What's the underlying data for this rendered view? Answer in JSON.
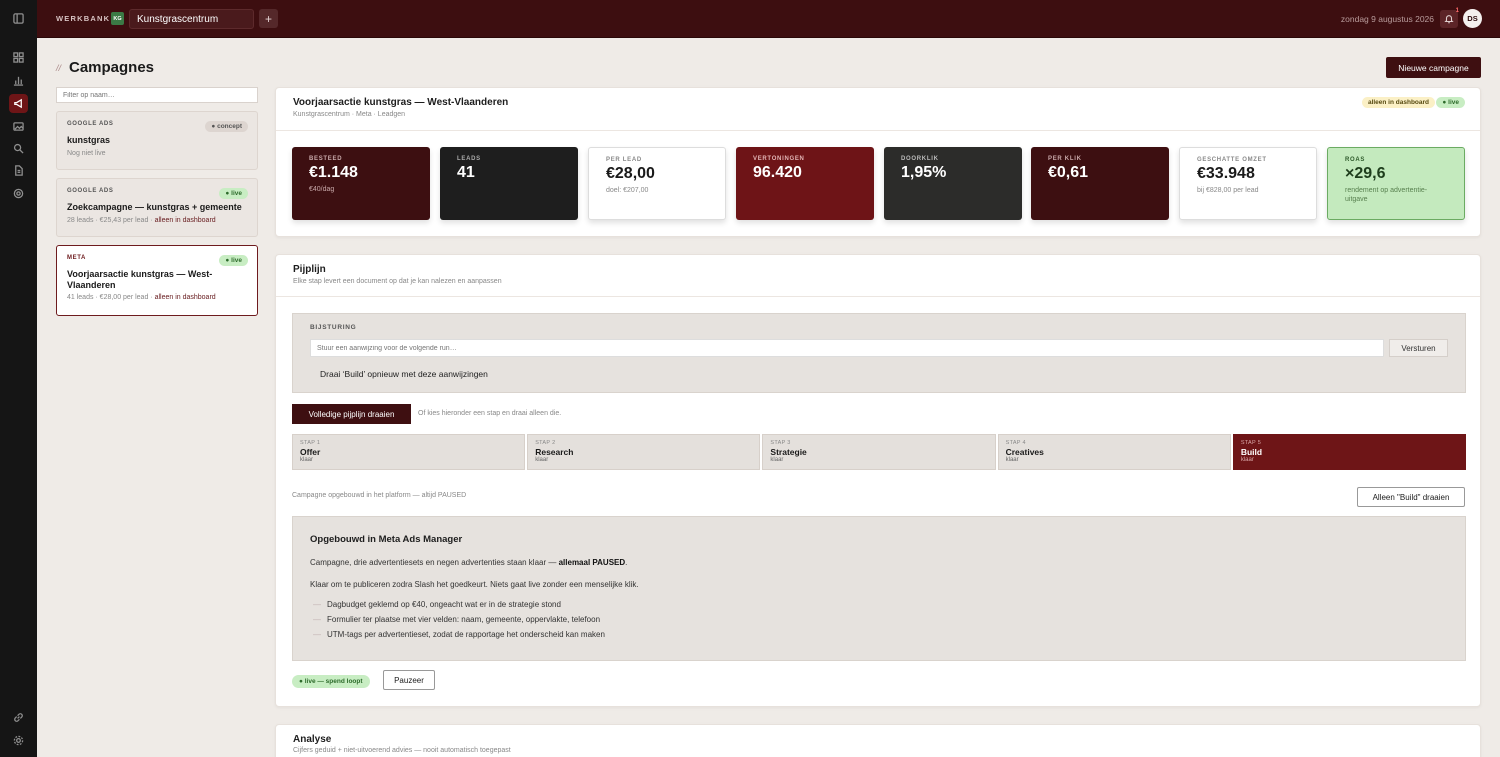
{
  "topbar": {
    "brand": "WERKBANK",
    "workspace_badge": "KG",
    "workspace": "Kunstgrascentrum",
    "add": "+",
    "date": "zondag 9 augustus 2026",
    "notif_count": "1",
    "avatar": "DS"
  },
  "sidebar_icons": [
    "toggle-sidebar-icon",
    "grid-icon",
    "bar-chart-icon",
    "megaphone-icon",
    "image-icon",
    "search-icon",
    "document-icon",
    "target-icon",
    "link-icon",
    "gear-icon"
  ],
  "page": {
    "slash": "//",
    "title": "Campagnes",
    "new_button": "Nieuwe campagne"
  },
  "list": {
    "filter_placeholder": "Filter op naam…",
    "items": [
      {
        "type": "GOOGLE ADS",
        "status": "● concept",
        "name": "kunstgras",
        "meta": "Nog niet live",
        "dash": ""
      },
      {
        "type": "GOOGLE ADS",
        "status": "● live",
        "name": "Zoekcampagne — kunstgras + gemeente",
        "meta": "28 leads · €25,43 per lead · ",
        "dash": "alleen in dashboard"
      },
      {
        "type": "META",
        "status": "● live",
        "name": "Voorjaarsactie kunstgras — West-Vlaanderen",
        "meta": "41 leads · €28,00 per lead · ",
        "dash": "alleen in dashboard"
      }
    ]
  },
  "detail": {
    "title": "Voorjaarsactie kunstgras — West-Vlaanderen",
    "subtitle": "Kunstgrascentrum · Meta · Leadgen",
    "tag_dashboard": "alleen in dashboard",
    "tag_live": "● live",
    "metrics": [
      {
        "label": "BESTEED",
        "value": "€1.148",
        "sub": "€40/dag"
      },
      {
        "label": "LEADS",
        "value": "41",
        "sub": ""
      },
      {
        "label": "PER LEAD",
        "value": "€28,00",
        "sub": "doel: €207,00"
      },
      {
        "label": "VERTONINGEN",
        "value": "96.420",
        "sub": ""
      },
      {
        "label": "DOORKLIK",
        "value": "1,95%",
        "sub": ""
      },
      {
        "label": "PER KLIK",
        "value": "€0,61",
        "sub": ""
      },
      {
        "label": "GESCHATTE OMZET",
        "value": "€33.948",
        "sub": "bij €828,00 per lead"
      },
      {
        "label": "ROAS",
        "value": "×29,6",
        "sub": "rendement op advertentie-uitgave"
      }
    ]
  },
  "pipeline": {
    "title": "Pijplijn",
    "subtitle": "Elke stap levert een document op dat je kan nalezen en aanpassen",
    "bijsturing_label": "BIJSTURING",
    "input_placeholder": "Stuur een aanwijzing voor de volgende run…",
    "send": "Versturen",
    "redo": "Draai ‘Build’ opnieuw met deze aanwijzingen",
    "run_full": "Volledige pijplijn draaien",
    "run_hint": "Of kies hieronder een stap en draai alleen die.",
    "steps": [
      {
        "n": "STAP 1",
        "name": "Offer",
        "status": "klaar"
      },
      {
        "n": "STAP 2",
        "name": "Research",
        "status": "klaar"
      },
      {
        "n": "STAP 3",
        "name": "Strategie",
        "status": "klaar"
      },
      {
        "n": "STAP 4",
        "name": "Creatives",
        "status": "klaar"
      },
      {
        "n": "STAP 5",
        "name": "Build",
        "status": "klaar"
      }
    ],
    "build_note": "Campagne opgebouwd in het platform — altijd PAUSED",
    "only_build": "Alleen \"Build\" draaien",
    "result": {
      "title": "Opgebouwd in Meta Ads Manager",
      "p1": "Campagne, drie advertentiesets en negen advertenties staan klaar — ",
      "p1_bold": "allemaal PAUSED",
      "p1_end": ".",
      "p2": "Klaar om te publiceren zodra Slash het goedkeurt. Niets gaat live zonder een menselijke klik.",
      "bullets": [
        "Dagbudget geklemd op €40, ongeacht wat er in de strategie stond",
        "Formulier ter plaatse met vier velden: naam, gemeente, oppervlakte, telefoon",
        "UTM-tags per advertentieset, zodat de rapportage het onderscheid kan maken"
      ]
    },
    "live_pill": "● live — spend loopt",
    "pause": "Pauzeer"
  },
  "analyse": {
    "title": "Analyse",
    "subtitle": "Cijfers geduid + niet-uitvoerend advies — nooit automatisch toegepast"
  }
}
